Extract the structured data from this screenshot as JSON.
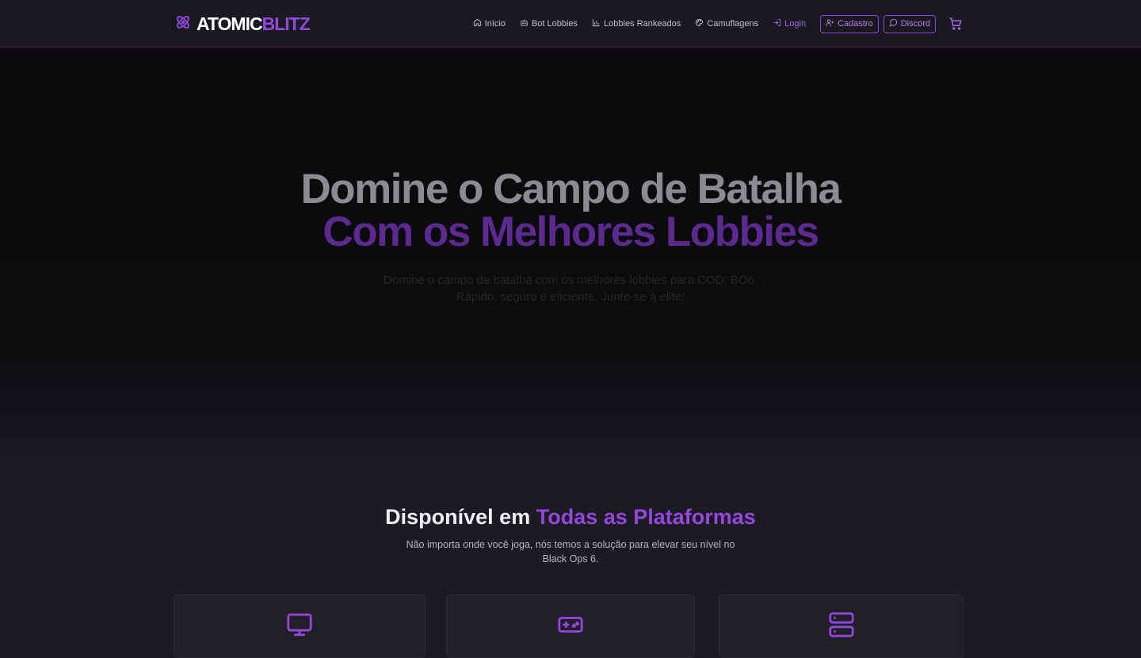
{
  "brand": {
    "part1": "ATOMIC",
    "part2": "BLITZ"
  },
  "nav": {
    "inicio": "Início",
    "bot_lobbies": "Bot Lobbies",
    "lobbies_rankeados": "Lobbies Rankeados",
    "camuflagens": "Camuflagens",
    "login": "Login",
    "cadastro": "Cadastro",
    "discord": "Discord"
  },
  "hero": {
    "title_line1": "Domine o Campo de Batalha",
    "title_line2": "Com os Melhores Lobbies",
    "subtitle_line1": "Domine o campo de batalha com os melhores lobbies para COD: BO6.",
    "subtitle_line2": "Rápido, seguro e eficiente. Junte-se à elite!"
  },
  "platforms": {
    "title_main": "Disponível em ",
    "title_accent": "Todas as Plataformas",
    "subtitle_line1": "Não importa onde você joga, nós temos a solução para elevar seu nível no",
    "subtitle_line2": "Black Ops 6.",
    "cards": [
      {
        "icon": "monitor-icon"
      },
      {
        "icon": "gamepad-icon"
      },
      {
        "icon": "server-icon"
      }
    ]
  },
  "colors": {
    "accent": "#9446e0",
    "background": "#1c1b22",
    "hero_background": "#0a0a0c"
  }
}
